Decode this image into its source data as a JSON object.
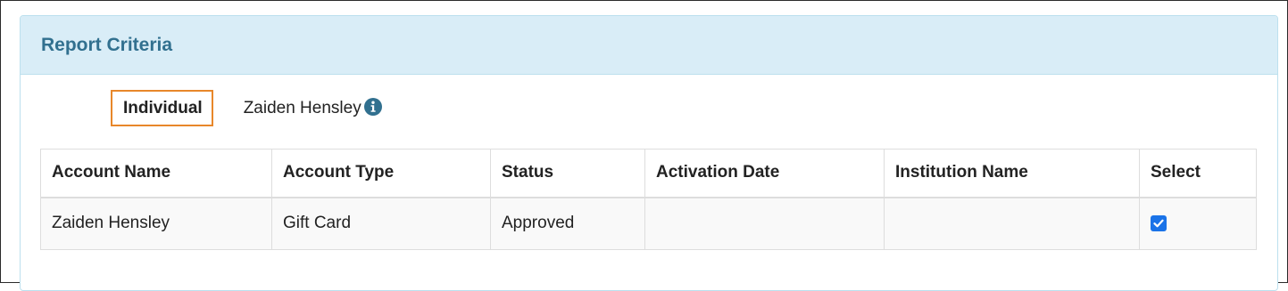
{
  "panel": {
    "title": "Report Criteria"
  },
  "criteria": {
    "label": "Individual",
    "value": "Zaiden Hensley",
    "info_icon": "info-circle-icon"
  },
  "table": {
    "headers": [
      "Account Name",
      "Account Type",
      "Status",
      "Activation Date",
      "Institution Name",
      "Select"
    ],
    "rows": [
      {
        "account_name": "Zaiden Hensley",
        "account_type": "Gift Card",
        "status": "Approved",
        "activation_date": "",
        "institution_name": "",
        "selected": true
      }
    ]
  },
  "colors": {
    "panel_heading_bg": "#d9edf7",
    "panel_title": "#31708f",
    "highlight_border": "#e8872a",
    "checkbox": "#1a73e8"
  }
}
